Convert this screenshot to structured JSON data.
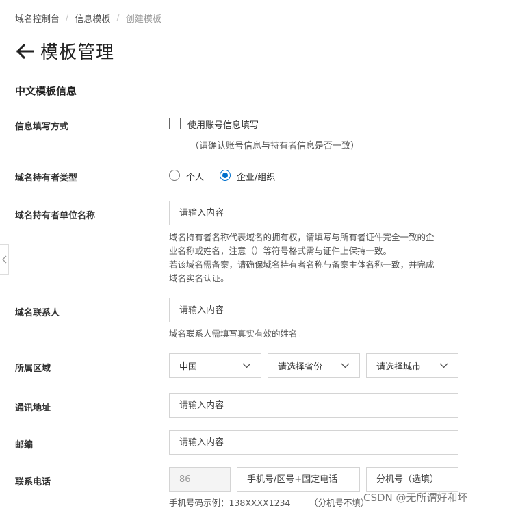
{
  "breadcrumb": [
    "域名控制台",
    "信息模板",
    "创建模板"
  ],
  "page": {
    "title": "模板管理",
    "section": "中文模板信息"
  },
  "form": {
    "fill_method": {
      "label": "信息填写方式",
      "checkbox_label": "使用账号信息填写",
      "checkbox_checked": false,
      "hint": "（请确认账号信息与持有者信息是否一致）"
    },
    "owner_type": {
      "label": "域名持有者类型",
      "options": [
        "个人",
        "企业/组织"
      ],
      "selected": "企业/组织"
    },
    "org_name": {
      "label": "域名持有者单位名称",
      "placeholder": "请输入内容",
      "help": [
        "域名持有者名称代表域名的拥有权，请填写与所有者证件完全一致的企",
        "业名称或姓名，注意（）等符号格式需与证件上保持一致。",
        "若该域名需备案，请确保域名持有者名称与备案主体名称一致，并完成",
        "域名实名认证。"
      ]
    },
    "contact": {
      "label": "域名联系人",
      "placeholder": "请输入内容",
      "help": "域名联系人需填写真实有效的姓名。"
    },
    "region": {
      "label": "所属区域",
      "country": "中国",
      "province_placeholder": "请选择省份",
      "city_placeholder": "请选择城市"
    },
    "address": {
      "label": "通讯地址",
      "placeholder": "请输入内容"
    },
    "postcode": {
      "label": "邮编",
      "placeholder": "请输入内容"
    },
    "phone": {
      "label": "联系电话",
      "country_code": "86",
      "number_placeholder": "手机号/区号+固定电话",
      "ext_placeholder": "分机号（选填）",
      "example": "手机号码示例：138XXXX1234",
      "ext_note": "（分机号不填）"
    }
  },
  "watermark": "CSDN @无所谓好和坏",
  "colors": {
    "accent": "#0070cc"
  }
}
